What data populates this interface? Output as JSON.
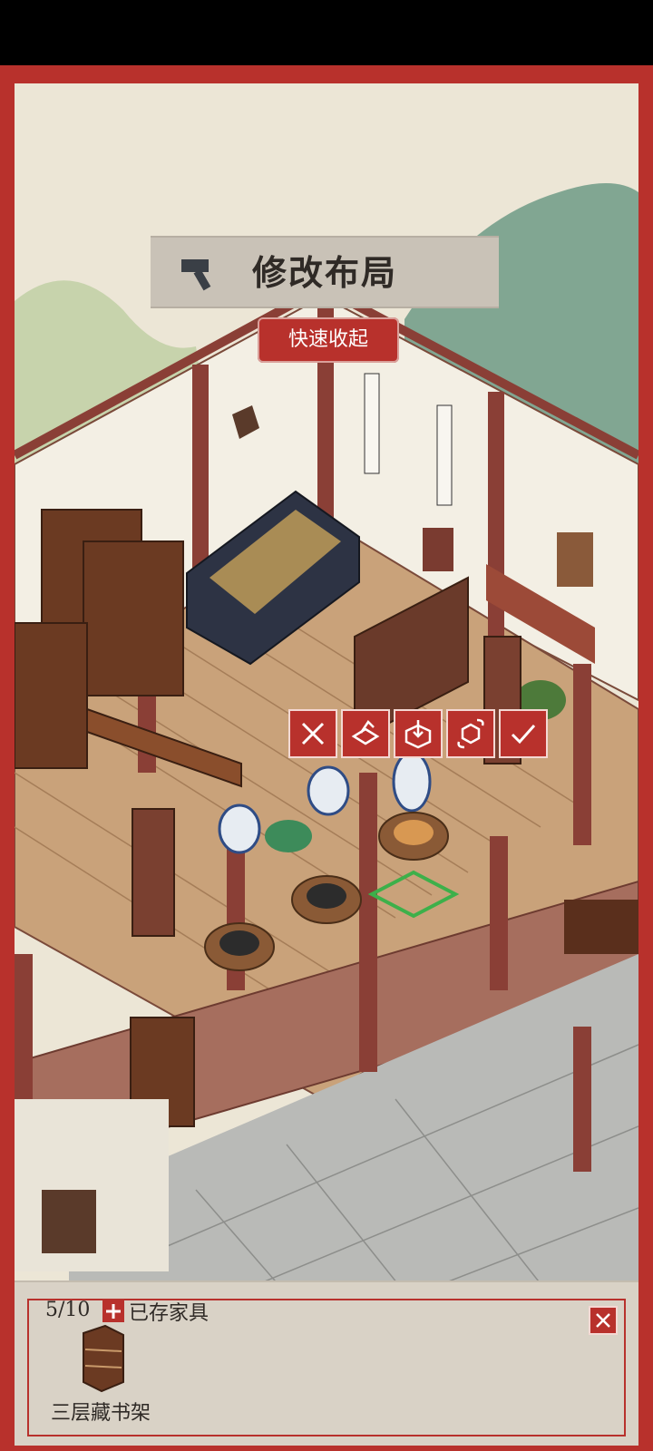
{
  "header": {
    "title": "修改布局",
    "quick_collapse_label": "快速收起"
  },
  "action_bar": {
    "buttons": [
      {
        "name": "cancel",
        "icon": "close-icon"
      },
      {
        "name": "store",
        "icon": "store-furniture-icon"
      },
      {
        "name": "place",
        "icon": "place-box-icon"
      },
      {
        "name": "rotate",
        "icon": "rotate-icon"
      },
      {
        "name": "confirm",
        "icon": "check-icon"
      }
    ]
  },
  "drawer": {
    "count": "5/10",
    "stored_label": "已存家具",
    "items": [
      {
        "name": "三层藏书架",
        "icon": "bookshelf-icon"
      }
    ]
  },
  "colors": {
    "frame_red": "#b8312c",
    "paper": "#ece6d6",
    "banner_grey": "#c9c2b7"
  }
}
